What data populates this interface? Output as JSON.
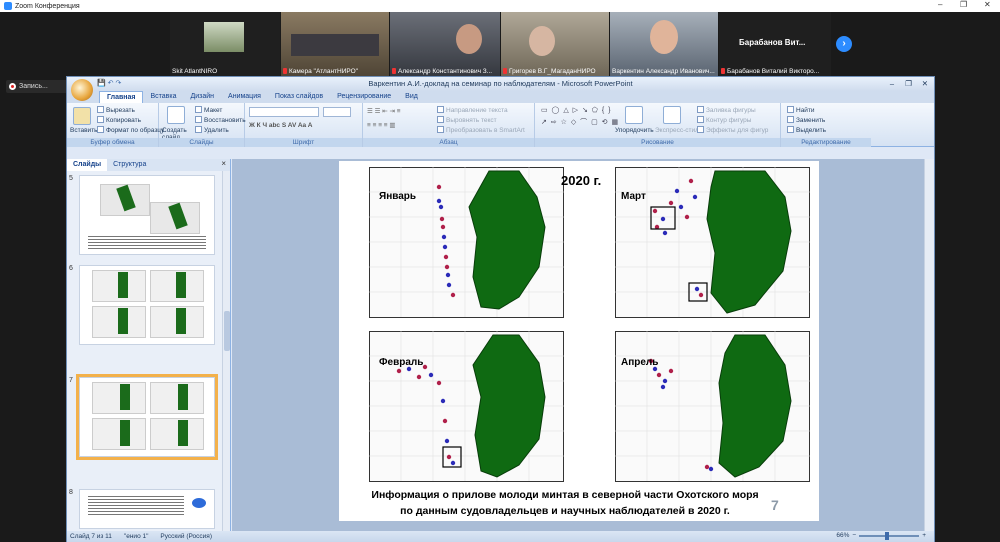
{
  "zoom": {
    "title": "Zoom Конференция",
    "recording_label": "Запись...",
    "participants": [
      {
        "name": "Skit AtlantNIRO",
        "muted": false
      },
      {
        "name": "Камера ''АтлантНИРО''",
        "muted": true
      },
      {
        "name": "Александр Константинович З...",
        "muted": true
      },
      {
        "name": "Григорев В.Г_МагаданНИРО",
        "muted": true
      },
      {
        "name": "Варкентин Александр Иванович...",
        "muted": false
      },
      {
        "name": "Барабанов Виталий Викторо...",
        "muted": true
      }
    ],
    "big_name": "Барабанов Вит...",
    "next_glyph": "›",
    "win_min": "–",
    "win_max": "❐",
    "win_close": "✕"
  },
  "ppt": {
    "title": "Варкентин А.И.-доклад на семинар по наблюдателям - Microsoft PowerPoint",
    "tabs": [
      "Главная",
      "Вставка",
      "Дизайн",
      "Анимация",
      "Показ слайдов",
      "Рецензирование",
      "Вид"
    ],
    "ribbon": {
      "clipboard": {
        "paste": "Вставить",
        "cut": "Вырезать",
        "copy": "Копировать",
        "format_painter": "Формат по образцу",
        "label": "Буфер обмена"
      },
      "slides": {
        "new_slide": "Создать слайд",
        "layout": "Макет",
        "reset": "Восстановить",
        "delete": "Удалить",
        "label": "Слайды"
      },
      "font": {
        "label": "Шрифт"
      },
      "paragraph": {
        "text_direction": "Направление текста",
        "align_text": "Выровнять текст",
        "smartart": "Преобразовать в SmartArt",
        "label": "Абзац"
      },
      "drawing": {
        "arrange": "Упорядочить",
        "quick_styles": "Экспресс-стили",
        "fill": "Заливка фигуры",
        "outline": "Контур фигуры",
        "effects": "Эффекты для фигур",
        "label": "Рисование"
      },
      "editing": {
        "find": "Найти",
        "replace": "Заменить",
        "select": "Выделить",
        "label": "Редактирование"
      }
    },
    "left_pane": {
      "tab_slides": "Слайды",
      "tab_outline": "Структура",
      "close_glyph": "×",
      "slide_numbers": [
        "5",
        "6",
        "7",
        "8"
      ]
    },
    "slide": {
      "title": "2020 г.",
      "months": [
        "Январь",
        "Март",
        "Февраль",
        "Апрель"
      ],
      "caption": "Информация о прилове молоди минтая в северной части Охотского моря по данным судовладельцев и научных наблюдателей в 2020 г.",
      "number": "7"
    },
    "status": {
      "slide": "Слайд 7 из 11",
      "theme": "\"енио 1\"",
      "language": "Русский (Россия)",
      "zoom": "66%"
    }
  }
}
